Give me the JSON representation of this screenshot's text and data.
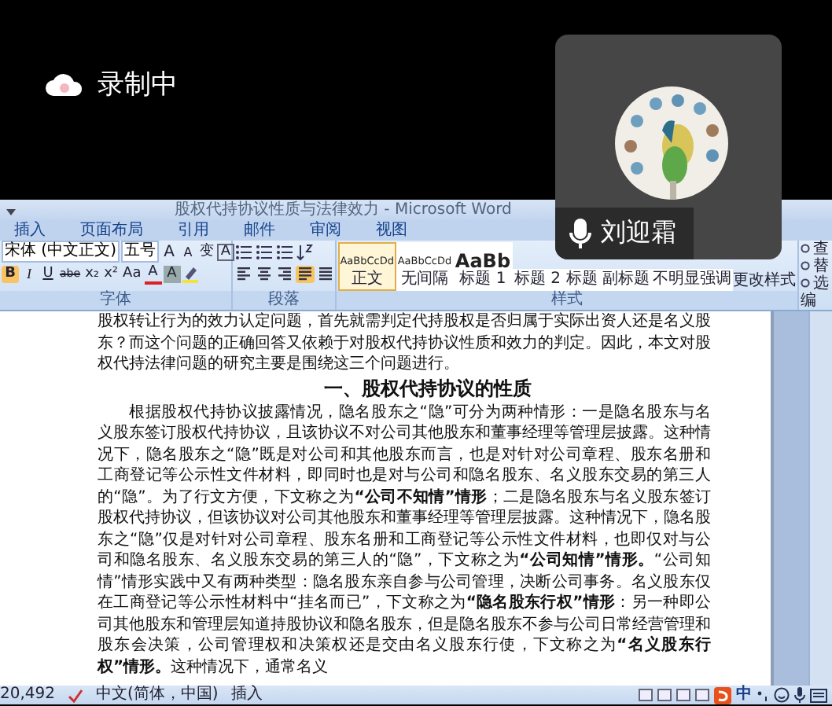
{
  "recording": {
    "label": "录制中"
  },
  "participant": {
    "name": "刘迎霜"
  },
  "word": {
    "title": "股权代持协议性质与法律效力 - Microsoft Word",
    "tabs": [
      {
        "label": "插入",
        "selected": false
      },
      {
        "label": "页面布局",
        "selected": false
      },
      {
        "label": "引用",
        "selected": false
      },
      {
        "label": "邮件",
        "selected": false
      },
      {
        "label": "审阅",
        "selected": false
      },
      {
        "label": "视图",
        "selected": false
      }
    ],
    "ribbon": {
      "font": {
        "family": "宋体 (中文正文)",
        "size": "五号",
        "label": "字体",
        "row1": [
          {
            "glyph": "A",
            "kind": "grow",
            "on": false
          },
          {
            "glyph": "A",
            "kind": "shrink",
            "on": false
          },
          {
            "glyph": "变",
            "kind": "plain",
            "on": false
          },
          {
            "glyph": "A",
            "kind": "border",
            "on": false
          }
        ],
        "row2": [
          {
            "glyph": "B",
            "kind": "bold",
            "on": true
          },
          {
            "glyph": "I",
            "kind": "italic",
            "on": false
          },
          {
            "glyph": "U",
            "kind": "underline",
            "on": false
          },
          {
            "glyph": "abe",
            "kind": "strike",
            "on": false
          },
          {
            "glyph": "x₂",
            "kind": "plain",
            "on": false
          },
          {
            "glyph": "x²",
            "kind": "plain",
            "on": false
          },
          {
            "glyph": "Aa",
            "kind": "plain",
            "on": false
          },
          {
            "glyph": "A",
            "kind": "color",
            "on": false
          },
          {
            "glyph": "A",
            "kind": "shade",
            "on": false
          }
        ]
      },
      "paragraph": {
        "label": "段落",
        "alignments": [
          {
            "kind": "left",
            "selected": false
          },
          {
            "kind": "center",
            "selected": false
          },
          {
            "kind": "right",
            "selected": false
          },
          {
            "kind": "justify",
            "selected": true
          },
          {
            "kind": "distributed",
            "selected": false
          }
        ]
      },
      "styles": {
        "label": "样式",
        "change": "更改样式",
        "items": [
          {
            "preview": "AaBbCcDd",
            "name": "正文",
            "selected": true
          },
          {
            "preview": "AaBbCcDd",
            "name": "无间隔",
            "selected": false
          },
          {
            "preview": "AaBb",
            "name": "标题 1",
            "selected": false
          },
          {
            "name": "标题 2",
            "selected": false
          },
          {
            "name": "标题",
            "selected": false
          },
          {
            "name": "副标题",
            "selected": false
          },
          {
            "name": "不明显强调",
            "selected": false
          }
        ]
      },
      "editing": {
        "label": "编",
        "items": [
          "查",
          "替",
          "选"
        ]
      }
    },
    "paragraphs": [
      {
        "kind": "text",
        "text": "股权转让行为的效力认定问题，首先就需判定代持股权是否归属于实际出资人还是名义股东？而这个问题的正确回答又依赖于对股权代持协议性质和效力的判定。因此，本文对股权代持法律问题的研究主要是围绕这三个问题进行。"
      },
      {
        "kind": "heading",
        "text": "一、股权代持协议的性质"
      },
      {
        "kind": "indented",
        "text": "根据股权代持协议披露情况，隐名股东之“隐”可分为两种情形：一是隐名股东与名义股东签订股权代持协议，且该协议不对公司其他股东和董事经理等管理层披露。这种情况下，隐名股东之“隐”既是对公司和其他股东而言，也是对针对公司章程、股东名册和工商登记等公示性文件材料，即同时也是对与公司和隐名股东、名义股东交易的第三人的“隐”。为了行文方便，下文称之为**“公司不知情”情形**；二是隐名股东与名义股东签订股权代持协议，但该协议对公司其他股东和董事经理等管理层披露。这种情况下，隐名股东之“隐”仅是对针对公司章程、股东名册和工商登记等公示性文件材料，也即仅对与公司和隐名股东、名义股东交易的第三人的“隐”，下文称之为**“公司知情”情形。**“公司知情”情形实践中又有两种类型：隐名股东亲自参与公司管理，决断公司事务。名义股东仅在工商登记等公示性材料中“挂名而已”，下文称之为**“隐名股东行权”情形**：另一种即公司其他股东和管理层知道持股协议和隐名股东，但是隐名股东不参与公司日常经营管理和股东会决策，公司管理权和决策权还是交由名义股东行使，下文称之为**“名义股东行权”情形。**这种情况下，通常名义"
      }
    ],
    "status": {
      "word_count": "20,492",
      "language": "中文(简体，中国)",
      "mode": "插入",
      "ime": "中"
    }
  }
}
